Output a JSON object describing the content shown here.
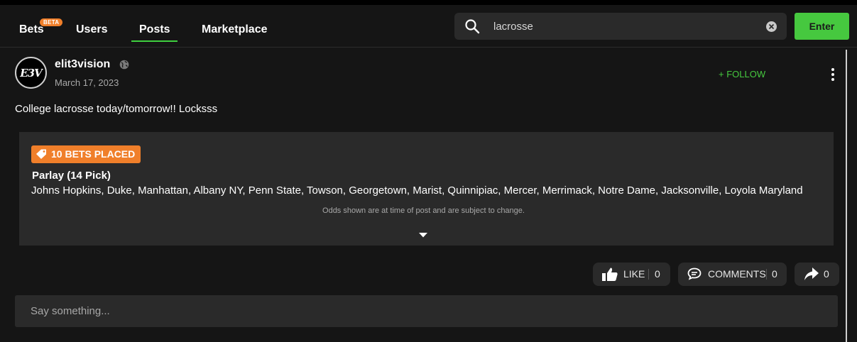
{
  "nav": {
    "tabs": [
      {
        "label": "Bets",
        "badge": "BETA"
      },
      {
        "label": "Users"
      },
      {
        "label": "Posts",
        "active": true
      },
      {
        "label": "Marketplace"
      }
    ]
  },
  "search": {
    "value": "lacrosse",
    "enter_label": "Enter"
  },
  "post": {
    "avatar_text": "E3V",
    "username": "elit3vision",
    "date": "March 17, 2023",
    "follow_label": "+ FOLLOW",
    "text": "College lacrosse today/tomorrow!! Locksss",
    "bet_card": {
      "badge": "10 BETS PLACED",
      "title": "Parlay (14 Pick)",
      "teams": "Johns Hopkins, Duke, Manhattan, Albany NY, Penn State, Towson, Georgetown, Marist, Quinnipiac, Mercer, Merrimack, Notre Dame, Jacksonville, Loyola Maryland",
      "note": "Odds shown are at time of post and are subject to change."
    },
    "actions": {
      "like_label": "LIKE",
      "like_count": "0",
      "comments_label": "COMMENTS",
      "comments_count": "0",
      "share_count": "0"
    },
    "comment_placeholder": "Say something..."
  },
  "colors": {
    "accent_green": "#46c83f",
    "badge_orange": "#f07f2a",
    "background": "#151515",
    "card": "#2a2a2a"
  }
}
